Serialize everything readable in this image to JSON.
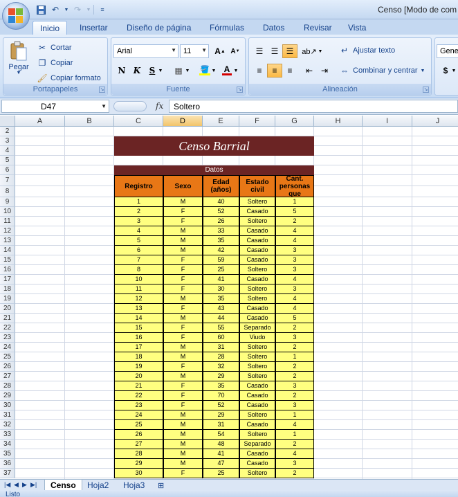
{
  "window": {
    "title": "Censo  [Modo de com"
  },
  "tabs": [
    "Inicio",
    "Insertar",
    "Diseño de página",
    "Fórmulas",
    "Datos",
    "Revisar",
    "Vista"
  ],
  "ribbon": {
    "clipboard": {
      "paste": "Pegar",
      "cut": "Cortar",
      "copy": "Copiar",
      "format_painter": "Copiar formato",
      "label": "Portapapeles"
    },
    "font": {
      "name": "Arial",
      "size": "11",
      "label": "Fuente"
    },
    "alignment": {
      "wrap": "Ajustar texto",
      "merge": "Combinar y centrar",
      "label": "Alineación"
    },
    "number": {
      "format": "Gene"
    }
  },
  "formula_bar": {
    "name_box": "D47",
    "fx": "fx",
    "value": "Soltero"
  },
  "columns": [
    "A",
    "B",
    "C",
    "D",
    "E",
    "F",
    "G",
    "H",
    "I",
    "J"
  ],
  "rows": [
    "2",
    "3",
    "4",
    "5",
    "6",
    "7",
    "8",
    "9",
    "10",
    "11",
    "12",
    "13",
    "14",
    "15",
    "16",
    "17",
    "18",
    "19",
    "20",
    "21",
    "22",
    "23",
    "24",
    "25",
    "26",
    "27",
    "28",
    "29",
    "30",
    "31",
    "32",
    "33",
    "34",
    "35",
    "36",
    "37"
  ],
  "sheet": {
    "banner": "Censo Barrial",
    "subheader": "Datos",
    "headers": [
      "Registro",
      "Sexo",
      "Edad (años)",
      "Estado civil",
      "Cant. personas que"
    ],
    "records": [
      [
        "1",
        "M",
        "40",
        "Soltero",
        "1"
      ],
      [
        "2",
        "F",
        "52",
        "Casado",
        "5"
      ],
      [
        "3",
        "F",
        "26",
        "Soltero",
        "2"
      ],
      [
        "4",
        "M",
        "33",
        "Casado",
        "4"
      ],
      [
        "5",
        "M",
        "35",
        "Casado",
        "4"
      ],
      [
        "6",
        "M",
        "42",
        "Casado",
        "3"
      ],
      [
        "7",
        "F",
        "59",
        "Casado",
        "3"
      ],
      [
        "8",
        "F",
        "25",
        "Soltero",
        "3"
      ],
      [
        "10",
        "F",
        "41",
        "Casado",
        "4"
      ],
      [
        "11",
        "F",
        "30",
        "Soltero",
        "3"
      ],
      [
        "12",
        "M",
        "35",
        "Soltero",
        "4"
      ],
      [
        "13",
        "F",
        "43",
        "Casado",
        "4"
      ],
      [
        "14",
        "M",
        "44",
        "Casado",
        "5"
      ],
      [
        "15",
        "F",
        "55",
        "Separado",
        "2"
      ],
      [
        "16",
        "F",
        "60",
        "Viudo",
        "3"
      ],
      [
        "17",
        "M",
        "31",
        "Soltero",
        "2"
      ],
      [
        "18",
        "M",
        "28",
        "Soltero",
        "1"
      ],
      [
        "19",
        "F",
        "32",
        "Soltero",
        "2"
      ],
      [
        "20",
        "M",
        "29",
        "Soltero",
        "2"
      ],
      [
        "21",
        "F",
        "35",
        "Casado",
        "3"
      ],
      [
        "22",
        "F",
        "70",
        "Casado",
        "2"
      ],
      [
        "23",
        "F",
        "52",
        "Casado",
        "3"
      ],
      [
        "24",
        "M",
        "29",
        "Soltero",
        "1"
      ],
      [
        "25",
        "M",
        "31",
        "Casado",
        "4"
      ],
      [
        "26",
        "M",
        "54",
        "Soltero",
        "1"
      ],
      [
        "27",
        "M",
        "48",
        "Separado",
        "2"
      ],
      [
        "28",
        "M",
        "41",
        "Casado",
        "4"
      ],
      [
        "29",
        "M",
        "47",
        "Casado",
        "3"
      ],
      [
        "30",
        "F",
        "25",
        "Soltero",
        "2"
      ]
    ]
  },
  "sheet_tabs": [
    "Censo",
    "Hoja2",
    "Hoja3"
  ],
  "status": "Listo"
}
